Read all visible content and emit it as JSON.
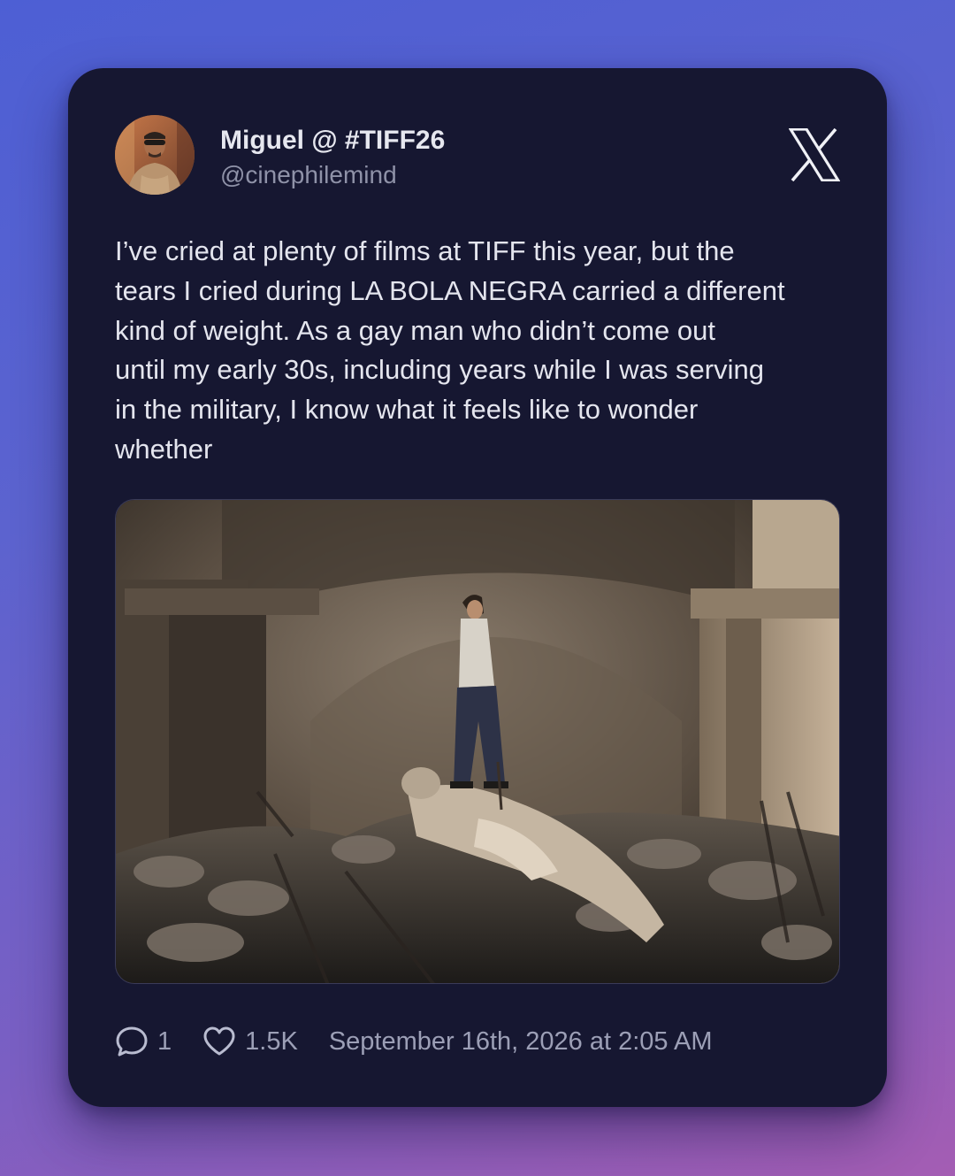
{
  "author": {
    "display_name": "Miguel @ #TIFF26",
    "handle": "@cinephilemind",
    "avatar": "avatar-photo"
  },
  "platform_icon": "x-logo-icon",
  "tweet": {
    "lines": [
      "I’ve cried at plenty of films at TIFF this year, but the",
      "tears I cried during LA BOLA NEGRA carried a different",
      "kind of weight. As a gay man who didn’t come out",
      "until my early 30s, including years while I was serving",
      "in the military, I know what it feels like to wonder",
      "whether"
    ]
  },
  "media": {
    "type": "photo",
    "icon": "film-still-image"
  },
  "stats": {
    "reply_icon": "comment-icon",
    "replies": "1",
    "like_icon": "heart-icon",
    "likes": "1.5K"
  },
  "timestamp": "September 16th, 2026 at 2:05 AM",
  "colors": {
    "card_background": "#161731",
    "text_primary": "#e4e5ee",
    "text_secondary": "#8f92a8",
    "gradient_start": "#4d5fd4",
    "gradient_end": "#a45db3"
  }
}
